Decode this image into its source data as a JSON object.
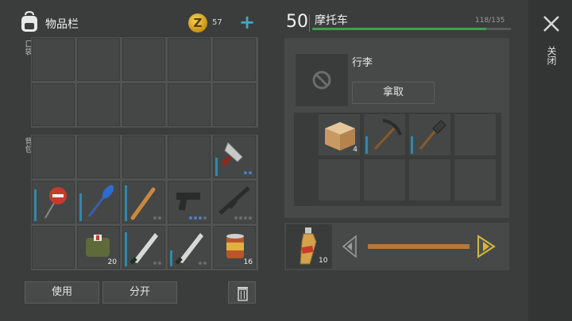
{
  "header": {
    "title": "物品栏",
    "coins": "57",
    "plus": "+"
  },
  "sections": {
    "pockets_label": "口袋",
    "backpack_label": "背包",
    "trunk_label": "行李"
  },
  "backpack_items": [
    {
      "name": "cleaver",
      "qty": "",
      "level": 0.45
    },
    {
      "name": "stop-sign",
      "qty": "",
      "level": 0.8
    },
    {
      "name": "paddle",
      "qty": "",
      "level": 0.7
    },
    {
      "name": "baseball-bat",
      "qty": "",
      "level": 0.9
    },
    {
      "name": "pistol",
      "qty": "",
      "level": 0
    },
    {
      "name": "assault-rifle",
      "qty": "",
      "level": 0
    },
    {
      "name": "medkit-bag",
      "qty": "20",
      "level": 0
    },
    {
      "name": "machete",
      "qty": "",
      "level": 0.85
    },
    {
      "name": "machete-2",
      "qty": "",
      "level": 0.4
    },
    {
      "name": "canned-food",
      "qty": "16",
      "level": 0
    }
  ],
  "actions": {
    "use": "使用",
    "split": "分开"
  },
  "vehicle": {
    "level": "50",
    "name": "摩托车",
    "capacity": "118/135",
    "fill_fraction": 0.874
  },
  "close_label": "关闭",
  "cargo": {
    "title": "行李",
    "take": "拿取"
  },
  "trunk_items": [
    {
      "name": "cardboard-box",
      "qty": "4"
    },
    {
      "name": "pickaxe",
      "qty": ""
    },
    {
      "name": "shovel",
      "qty": ""
    }
  ],
  "fuel": {
    "qty": "10",
    "item": "gasoline-bottle"
  },
  "colors": {
    "accent": "#41a8c8",
    "progress": "#3fa04a",
    "slider": "#b37a3c",
    "arrow": "#d8b63a"
  }
}
